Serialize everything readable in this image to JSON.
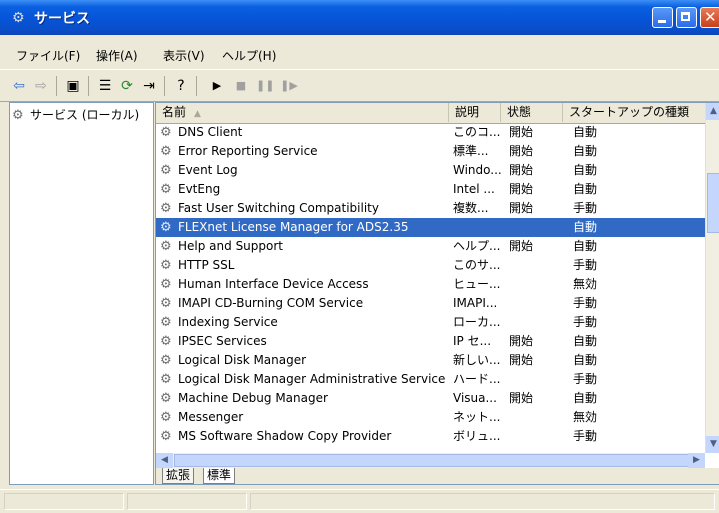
{
  "window": {
    "title": "サービス"
  },
  "menu": [
    "ファイル(F)",
    "操作(A)",
    "表示(V)",
    "ヘルプ(H)"
  ],
  "tree": {
    "root_label": "サービス (ローカル)"
  },
  "columns": {
    "name": "名前",
    "description": "説明",
    "status": "状態",
    "startup": "スタートアップの種類"
  },
  "services": [
    {
      "name": "DNS Client",
      "description": "このコ...",
      "status": "開始",
      "startup": "自動"
    },
    {
      "name": "Error Reporting Service",
      "description": "標準...",
      "status": "開始",
      "startup": "自動"
    },
    {
      "name": "Event Log",
      "description": "Windo...",
      "status": "開始",
      "startup": "自動"
    },
    {
      "name": "EvtEng",
      "description": "Intel ...",
      "status": "開始",
      "startup": "自動"
    },
    {
      "name": "Fast User Switching Compatibility",
      "description": "複数...",
      "status": "開始",
      "startup": "手動"
    },
    {
      "name": "FLEXnet License Manager for ADS2.35",
      "description": "",
      "status": "",
      "startup": "自動"
    },
    {
      "name": "Help and Support",
      "description": "ヘルプ...",
      "status": "開始",
      "startup": "自動"
    },
    {
      "name": "HTTP SSL",
      "description": "このサ...",
      "status": "",
      "startup": "手動"
    },
    {
      "name": "Human Interface Device Access",
      "description": "ヒュー...",
      "status": "",
      "startup": "無効"
    },
    {
      "name": "IMAPI CD-Burning COM Service",
      "description": "IMAPI...",
      "status": "",
      "startup": "手動"
    },
    {
      "name": "Indexing Service",
      "description": "ローカ...",
      "status": "",
      "startup": "手動"
    },
    {
      "name": "IPSEC Services",
      "description": "IP セ...",
      "status": "開始",
      "startup": "自動"
    },
    {
      "name": "Logical Disk Manager",
      "description": "新しい...",
      "status": "開始",
      "startup": "自動"
    },
    {
      "name": "Logical Disk Manager Administrative Service",
      "description": "ハード...",
      "status": "",
      "startup": "手動"
    },
    {
      "name": "Machine Debug Manager",
      "description": "Visua...",
      "status": "開始",
      "startup": "自動"
    },
    {
      "name": "Messenger",
      "description": "ネット...",
      "status": "",
      "startup": "無効"
    },
    {
      "name": "MS Software Shadow Copy Provider",
      "description": "ボリュ...",
      "status": "",
      "startup": "手動"
    }
  ],
  "selected_service": "FLEXnet License Manager for ADS2.35",
  "tabs": {
    "extended": "拡張",
    "standard": "標準"
  },
  "colors": {
    "selection": "#316ac5",
    "titlebar": "#0654d8"
  }
}
